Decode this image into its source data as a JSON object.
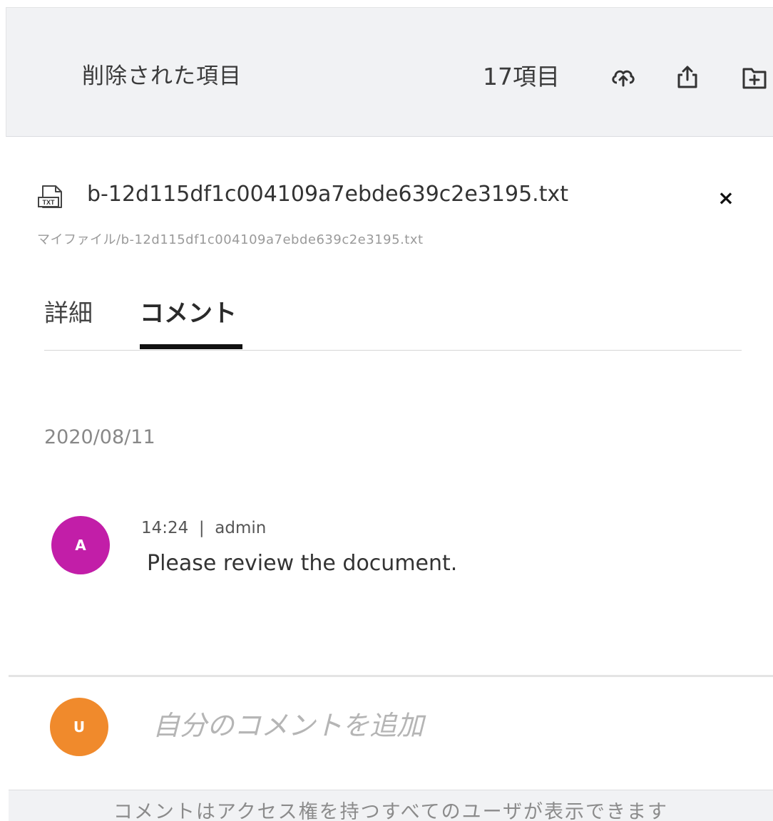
{
  "header": {
    "title": "削除された項目",
    "item_count": "17項目",
    "icons": [
      "cloud-upload-icon",
      "share-upload-icon",
      "new-folder-icon"
    ]
  },
  "file": {
    "type_icon_label": "TXT",
    "name": "b-12d115df1c004109a7ebde639c2e3195.txt",
    "path": "マイファイル/b-12d115df1c004109a7ebde639c2e3195.txt",
    "close_symbol": "×"
  },
  "tabs": [
    {
      "label": "詳細",
      "active": false
    },
    {
      "label": "コメント",
      "active": true
    }
  ],
  "comments": {
    "date": "2020/08/11",
    "items": [
      {
        "avatar_initial": "A",
        "avatar_color": "#c21ea8",
        "time": "14:24",
        "separator": "|",
        "author": "admin",
        "text": "Please review the document."
      }
    ]
  },
  "composer": {
    "avatar_initial": "U",
    "avatar_color": "#f08a2c",
    "placeholder": "自分のコメントを追加"
  },
  "footer": {
    "notice": "コメントはアクセス権を持つすべてのユーザが表示できます"
  }
}
